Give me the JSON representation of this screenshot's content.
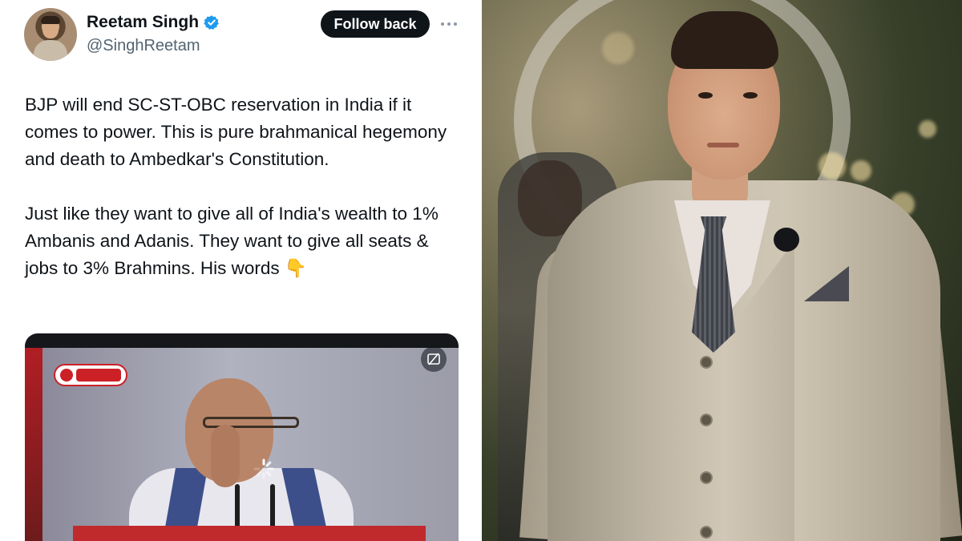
{
  "tweet": {
    "author": {
      "display_name": "Reetam Singh",
      "handle": "@SinghReetam",
      "verified": true,
      "verified_color": "#1d9bf0"
    },
    "follow_button_label": "Follow back",
    "more_icon": "more-horizontal-icon",
    "text": "BJP will end SC-ST-OBC reservation in India if it comes to power. This is pure brahmanical hegemony and death to Ambedkar's Constitution.\n\nJust like they want to give all of India's wealth to 1% Ambanis and Adanis. They want to give all seats & jobs to 3% Brahmins. His words",
    "text_emoji": "👇",
    "media": {
      "type": "video",
      "gif_toggle_icon": "gif-off-icon",
      "loading_icon": "spinner-icon"
    }
  },
  "photo": {
    "subject": "man-in-beige-three-piece-suit"
  }
}
